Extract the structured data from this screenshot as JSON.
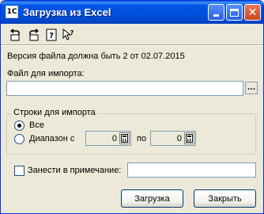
{
  "window": {
    "title": "Загрузка из Excel",
    "icon_label": "1C"
  },
  "toolbar": {
    "icons": [
      "undo-icon",
      "redo-icon",
      "help-icon",
      "context-help-icon"
    ]
  },
  "info_text": "Версия файла должна быть 2 от 02.07.2015",
  "file_import": {
    "label": "Файл для импорта:",
    "value": "",
    "browse_label": "..."
  },
  "rows_group": {
    "title": "Строки для импорта",
    "options": [
      {
        "label": "Все",
        "checked": true
      },
      {
        "label": "Диапазон с",
        "checked": false
      }
    ],
    "range_from": "0",
    "range_to_label": "по",
    "range_to": "0"
  },
  "note": {
    "label": "Занести в примечание:",
    "checked": false,
    "value": ""
  },
  "buttons": {
    "load": "Загрузка",
    "close": "Закрыть"
  },
  "colors": {
    "titlebar": "#0055e5",
    "dialog_bg": "#ece9d8",
    "field_border": "#7f9db9"
  }
}
